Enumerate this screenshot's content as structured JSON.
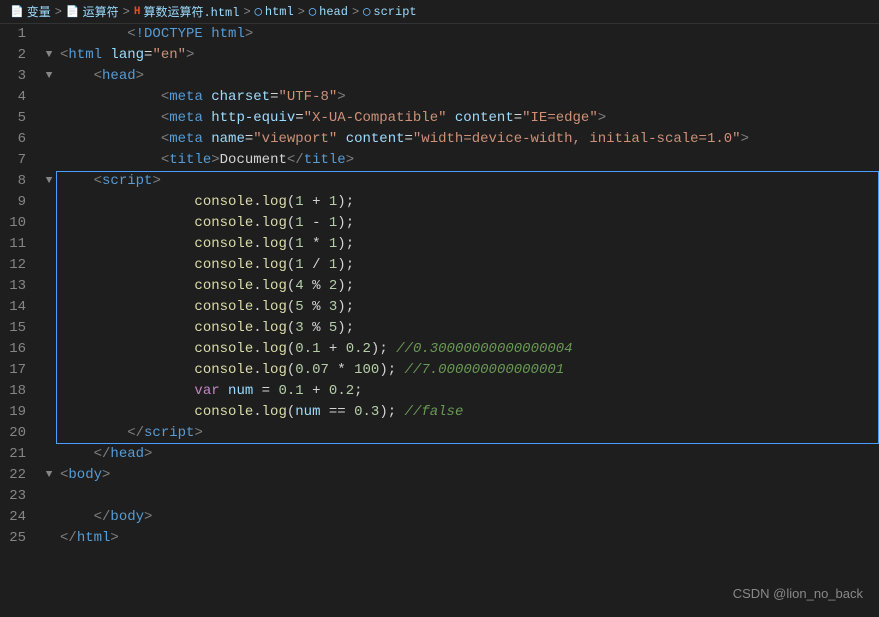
{
  "breadcrumb": {
    "items": [
      {
        "label": "变量",
        "icon": "variable",
        "color": "#9cdcfe"
      },
      {
        "label": "运算符",
        "icon": "variable",
        "color": "#9cdcfe"
      },
      {
        "label": "算数运算符.html",
        "icon": "html",
        "color": "#e44d26"
      },
      {
        "label": "html",
        "icon": "circle",
        "color": "#75beff"
      },
      {
        "label": "head",
        "icon": "circle",
        "color": "#75beff"
      },
      {
        "label": "script",
        "icon": "circle",
        "color": "#75beff"
      }
    ],
    "separators": [
      ">",
      ">",
      ">",
      ">",
      ">"
    ]
  },
  "lines": [
    {
      "num": 1,
      "indent": 2,
      "arrow": null,
      "html": "<span class='tag-angle'>&lt;</span><span class='tag'>!DOCTYPE html</span><span class='tag-angle'>&gt;</span>"
    },
    {
      "num": 2,
      "indent": 0,
      "arrow": "down",
      "html": "<span class='tag-angle'>&lt;</span><span class='tag'>html</span> <span class='attr-name'>lang</span><span class='punctuation'>=</span><span class='attr-value'>\"en\"</span><span class='tag-angle'>&gt;</span>"
    },
    {
      "num": 3,
      "indent": 1,
      "arrow": "down",
      "html": "<span class='tag-angle'>&lt;</span><span class='tag'>head</span><span class='tag-angle'>&gt;</span>"
    },
    {
      "num": 4,
      "indent": 3,
      "arrow": null,
      "html": "<span class='tag-angle'>&lt;</span><span class='tag'>meta</span> <span class='attr-name'>charset</span><span class='punctuation'>=</span><span class='attr-value'>\"UTF-8\"</span><span class='tag-angle'>&gt;</span>"
    },
    {
      "num": 5,
      "indent": 3,
      "arrow": null,
      "html": "<span class='tag-angle'>&lt;</span><span class='tag'>meta</span> <span class='attr-name'>http-equiv</span><span class='punctuation'>=</span><span class='attr-value'>\"X-UA-Compatible\"</span> <span class='attr-name'>content</span><span class='punctuation'>=</span><span class='attr-value'>\"IE=edge\"</span><span class='tag-angle'>&gt;</span>"
    },
    {
      "num": 6,
      "indent": 3,
      "arrow": null,
      "html": "<span class='tag-angle'>&lt;</span><span class='tag'>meta</span> <span class='attr-name'>name</span><span class='punctuation'>=</span><span class='attr-value'>\"viewport\"</span> <span class='attr-name'>content</span><span class='punctuation'>=</span><span class='attr-value'>\"width=device-width, initial-scale=1.0\"</span><span class='tag-angle'>&gt;</span>"
    },
    {
      "num": 7,
      "indent": 3,
      "arrow": null,
      "html": "<span class='tag-angle'>&lt;</span><span class='tag'>title</span><span class='tag-angle'>&gt;</span><span class='text-content'>Document</span><span class='tag-angle'>&lt;/</span><span class='tag'>title</span><span class='tag-angle'>&gt;</span>"
    },
    {
      "num": 8,
      "indent": 1,
      "arrow": "down",
      "html": "<span class='tag-angle'>&lt;</span><span class='tag'>script</span><span class='tag-angle'>&gt;</span>",
      "scriptStart": true
    },
    {
      "num": 9,
      "indent": 4,
      "arrow": null,
      "html": "<span class='method'>console</span><span class='punctuation'>.</span><span class='method'>log</span><span class='punctuation'>(</span><span class='number-val'>1</span> <span class='operator'>+</span> <span class='number-val'>1</span><span class='punctuation'>);</span>"
    },
    {
      "num": 10,
      "indent": 4,
      "arrow": null,
      "html": "<span class='method'>console</span><span class='punctuation'>.</span><span class='method'>log</span><span class='punctuation'>(</span><span class='number-val'>1</span> <span class='operator'>-</span> <span class='number-val'>1</span><span class='punctuation'>);</span>"
    },
    {
      "num": 11,
      "indent": 4,
      "arrow": null,
      "html": "<span class='method'>console</span><span class='punctuation'>.</span><span class='method'>log</span><span class='punctuation'>(</span><span class='number-val'>1</span> <span class='operator'>*</span> <span class='number-val'>1</span><span class='punctuation'>);</span>"
    },
    {
      "num": 12,
      "indent": 4,
      "arrow": null,
      "html": "<span class='method'>console</span><span class='punctuation'>.</span><span class='method'>log</span><span class='punctuation'>(</span><span class='number-val'>1</span> <span class='operator'>/</span> <span class='number-val'>1</span><span class='punctuation'>);</span>"
    },
    {
      "num": 13,
      "indent": 4,
      "arrow": null,
      "html": "<span class='method'>console</span><span class='punctuation'>.</span><span class='method'>log</span><span class='punctuation'>(</span><span class='number-val'>4</span> <span class='operator'>%</span> <span class='number-val'>2</span><span class='punctuation'>);</span>"
    },
    {
      "num": 14,
      "indent": 4,
      "arrow": null,
      "html": "<span class='method'>console</span><span class='punctuation'>.</span><span class='method'>log</span><span class='punctuation'>(</span><span class='number-val'>5</span> <span class='operator'>%</span> <span class='number-val'>3</span><span class='punctuation'>);</span>"
    },
    {
      "num": 15,
      "indent": 4,
      "arrow": null,
      "html": "<span class='method'>console</span><span class='punctuation'>.</span><span class='method'>log</span><span class='punctuation'>(</span><span class='number-val'>3</span> <span class='operator'>%</span> <span class='number-val'>5</span><span class='punctuation'>);</span>"
    },
    {
      "num": 16,
      "indent": 4,
      "arrow": null,
      "html": "<span class='method'>console</span><span class='punctuation'>.</span><span class='method'>log</span><span class='punctuation'>(</span><span class='number-val'>0.1</span> <span class='operator'>+</span> <span class='number-val'>0.2</span><span class='punctuation'>);</span> <span class='comment'>//0.30000000000000004</span>"
    },
    {
      "num": 17,
      "indent": 4,
      "arrow": null,
      "html": "<span class='method'>console</span><span class='punctuation'>.</span><span class='method'>log</span><span class='punctuation'>(</span><span class='number-val'>0.07</span> <span class='operator'>*</span> <span class='number-val'>100</span><span class='punctuation'>);</span> <span class='comment'>//7.000000000000001</span>"
    },
    {
      "num": 18,
      "indent": 4,
      "arrow": null,
      "html": "<span class='keyword'>var</span> <span class='var-name'>num</span> <span class='operator'>=</span> <span class='number-val'>0.1</span> <span class='operator'>+</span> <span class='number-val'>0.2</span><span class='punctuation'>;</span>"
    },
    {
      "num": 19,
      "indent": 4,
      "arrow": null,
      "html": "<span class='method'>console</span><span class='punctuation'>.</span><span class='method'>log</span><span class='punctuation'>(</span><span class='var-name'>num</span> <span class='operator'>==</span> <span class='number-val'>0.3</span><span class='punctuation'>);</span> <span class='comment'>//false</span>",
      "scriptEnd": true
    },
    {
      "num": 20,
      "indent": 2,
      "arrow": null,
      "html": "<span class='tag-angle'>&lt;/</span><span class='tag'>script</span><span class='tag-angle'>&gt;</span>"
    },
    {
      "num": 21,
      "indent": 1,
      "arrow": null,
      "html": "<span class='tag-angle'>&lt;/</span><span class='tag'>head</span><span class='tag-angle'>&gt;</span>"
    },
    {
      "num": 22,
      "indent": 0,
      "arrow": "down",
      "html": "<span class='tag-angle'>&lt;</span><span class='tag'>body</span><span class='tag-angle'>&gt;</span>"
    },
    {
      "num": 23,
      "indent": 1,
      "arrow": null,
      "html": ""
    },
    {
      "num": 24,
      "indent": 1,
      "arrow": null,
      "html": "<span class='tag-angle'>&lt;/</span><span class='tag'>body</span><span class='tag-angle'>&gt;</span>"
    },
    {
      "num": 25,
      "indent": 0,
      "arrow": null,
      "html": "<span class='tag-angle'>&lt;/</span><span class='tag'>html</span><span class='tag-angle'>&gt;</span>"
    }
  ],
  "watermark": {
    "text": "CSDN @lion_no_back"
  }
}
